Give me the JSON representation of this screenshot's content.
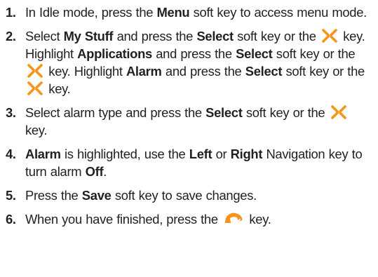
{
  "steps": [
    {
      "number": "1.",
      "t1": "In Idle mode, press the ",
      "b1": "Menu",
      "t2": " soft key to access menu mode."
    },
    {
      "number": "2.",
      "t1": "Select ",
      "b1": "My Stuff",
      "t2": " and press the ",
      "b2": "Select",
      "t3": " soft key or the ",
      "t4": " key. Highlight ",
      "b3": "Applications",
      "t5": " and press the ",
      "b4": "Select",
      "t6": " soft key or the ",
      "t7": " key. Highlight ",
      "b5": "Alarm",
      "t8": " and press the ",
      "b6": "Select",
      "t9": " soft key or the ",
      "t10": " key."
    },
    {
      "number": "3.",
      "t1": "Select alarm type and press the ",
      "b1": "Select",
      "t2": " soft key or the ",
      "t3": " key."
    },
    {
      "number": "4.",
      "b1": "Alarm",
      "t1": " is highlighted, use the ",
      "b2": "Left",
      "t2": " or ",
      "b3": "Right",
      "t3": " Navigation key to turn alarm ",
      "b4": "Off",
      "t4": "."
    },
    {
      "number": "5.",
      "t1": "Press the ",
      "b1": "Save",
      "t2": " soft key to save changes."
    },
    {
      "number": "6.",
      "t1": "When you have finished, press the ",
      "t2": " key."
    }
  ],
  "icons": {
    "select_key": "navigation-select-key-icon",
    "end_key": "end-call-key-icon"
  },
  "colors": {
    "text": "#231f20",
    "icon_orange": "#f7941d"
  }
}
